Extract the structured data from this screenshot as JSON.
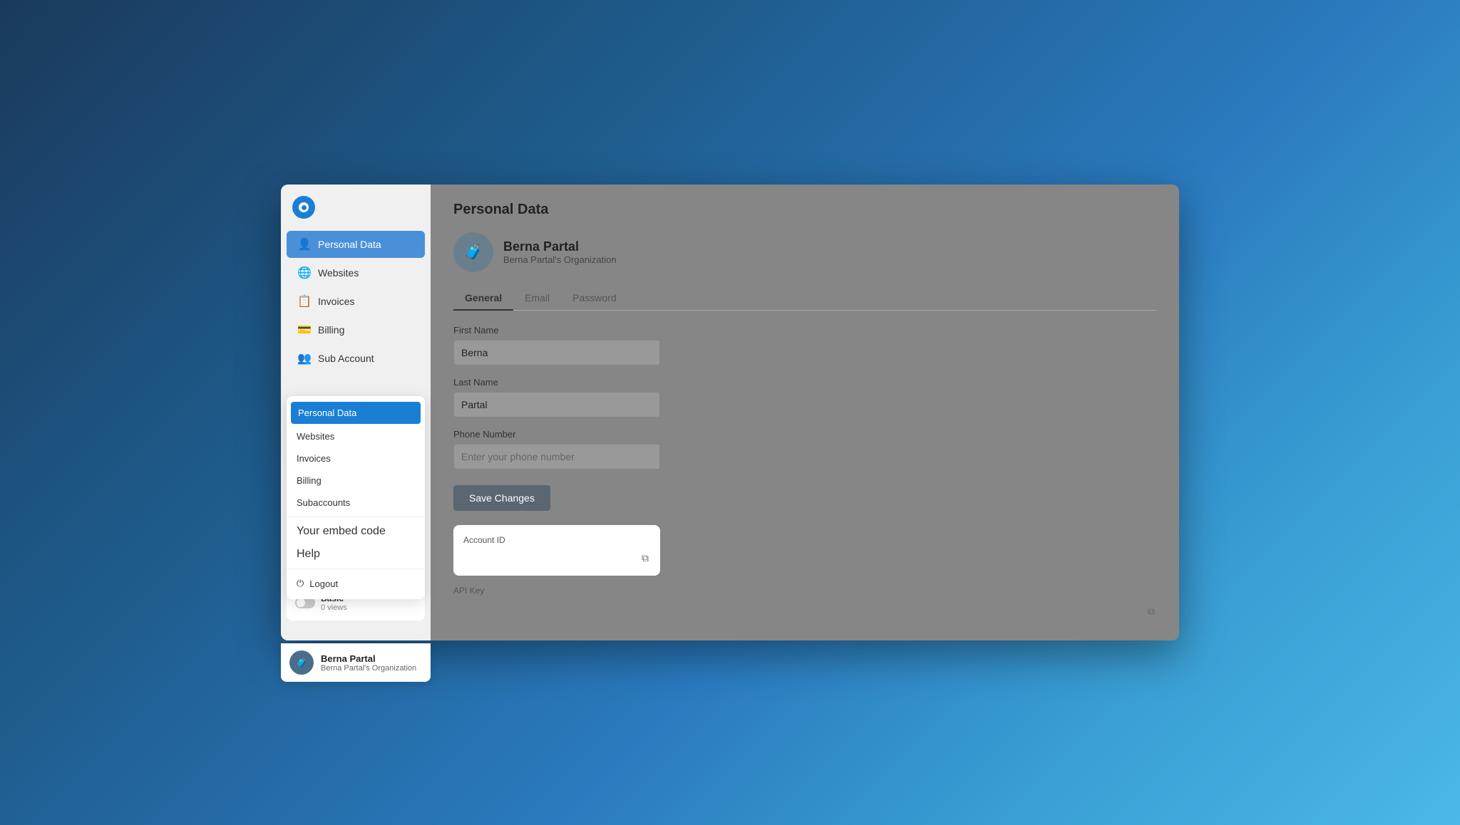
{
  "app": {
    "title": "Personal Data"
  },
  "sidebar": {
    "nav_items": [
      {
        "id": "personal-data",
        "label": "Personal Data",
        "icon": "👤",
        "active": true
      },
      {
        "id": "websites",
        "label": "Websites",
        "icon": "🌐",
        "active": false
      },
      {
        "id": "invoices",
        "label": "Invoices",
        "icon": "📋",
        "active": false
      },
      {
        "id": "billing",
        "label": "Billing",
        "icon": "💳",
        "active": false
      },
      {
        "id": "sub-account",
        "label": "Sub Account",
        "icon": "👥",
        "active": false
      }
    ],
    "profile_card": {
      "name": "Berna Partal",
      "org": "Berna Partal's Organization",
      "plan_name": "Basic",
      "plan_views": "0 views"
    },
    "dropdown": {
      "items": [
        {
          "id": "personal-data",
          "label": "Personal Data",
          "active": true
        },
        {
          "id": "websites",
          "label": "Websites",
          "active": false
        },
        {
          "id": "invoices",
          "label": "Invoices",
          "active": false
        },
        {
          "id": "billing",
          "label": "Billing",
          "active": false
        },
        {
          "id": "subaccounts",
          "label": "Subaccounts",
          "active": false
        }
      ],
      "extra_links": [
        {
          "id": "embed-code",
          "label": "Your embed code"
        },
        {
          "id": "help",
          "label": "Help"
        }
      ],
      "logout_label": "Logout"
    },
    "user_bar": {
      "name": "Berna Partal",
      "org": "Berna Partal's Organization"
    }
  },
  "main": {
    "page_title": "Personal Data",
    "profile": {
      "name": "Berna Partal",
      "org": "Berna Partal's Organization"
    },
    "tabs": [
      {
        "id": "general",
        "label": "General",
        "active": true
      },
      {
        "id": "email",
        "label": "Email",
        "active": false
      },
      {
        "id": "password",
        "label": "Password",
        "active": false
      }
    ],
    "form": {
      "first_name_label": "First Name",
      "first_name_value": "Berna",
      "last_name_label": "Last Name",
      "last_name_value": "Partal",
      "phone_label": "Phone Number",
      "phone_placeholder": "Enter your phone number",
      "save_button": "Save Changes"
    },
    "account_id": {
      "label": "Account ID",
      "value": ""
    },
    "api_key": {
      "label": "API Key",
      "value": ""
    }
  }
}
